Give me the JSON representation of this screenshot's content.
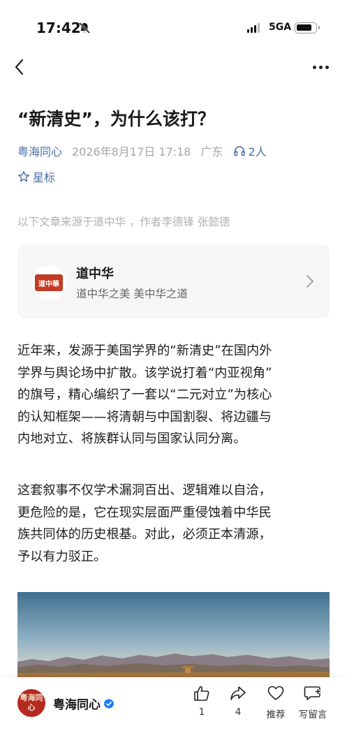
{
  "status_bar": {
    "time": "17:42",
    "network": "5GA",
    "icons": [
      "bell-slash-icon",
      "signal-icon",
      "battery-icon"
    ]
  },
  "nav": {
    "back_icon": "chevron-left-icon",
    "more_icon": "more-dots-icon"
  },
  "article": {
    "title": "“新清史”，为什么该打？",
    "author": "粤海同心",
    "date": "2026年8月17日 17:18",
    "region": "广东",
    "listeners": "2人",
    "star_label": "星标",
    "source_note": "以下文章来源于道中华 ，作者李德锋 张懿德",
    "paragraph1_lines": [
      "近年来，发源于美国学界的“新清史”在国内外",
      "学界与舆论场中扩散。该学说打着“内亚视角”",
      "的旗号，精心编织了一套以“二元对立”为核心",
      "的认知框架——将清朝与中国割裂、将边疆与",
      "内地对立、将族群认同与国家认同分离。"
    ],
    "paragraph2_lines": [
      "这套叙事不仅学术漏洞百出、逻辑难以自洽，",
      "更危险的是，它在现实层面严重侵蚀着中华民",
      "族共同体的历史根基。对此，必须正本清源，",
      "予以有力驳正。"
    ]
  },
  "source_card": {
    "name": "道中华",
    "slogan": "道中华之美 美中华之道",
    "logo_text": "道中華"
  },
  "bottom_bar": {
    "account": "粤海同心",
    "avatar_text": "粤海同心",
    "like_count": "1",
    "share_count": "4",
    "recommend_label": "推荐",
    "comment_label": "写留言"
  },
  "colors": {
    "link_blue": "#4a6fa5",
    "meta_gray": "#a6a6a6",
    "avatar_red": "#b52a1f",
    "verified_blue": "#1a7cf0"
  }
}
